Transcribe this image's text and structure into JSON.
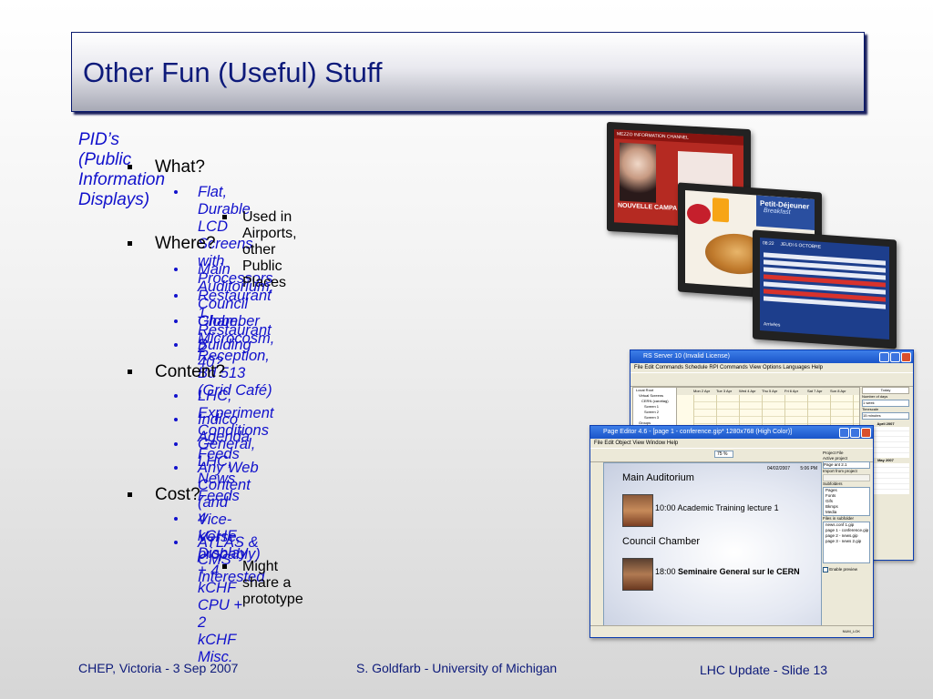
{
  "slide": {
    "title": "Other Fun (Useful) Stuff",
    "outline": {
      "heading": "PID’s (Public Information Displays)",
      "what_label": "What?",
      "what_item": "Flat, Durable LCD Screens with Processors",
      "what_sub": "Used in Airports, other Public Places",
      "where_label": "Where?",
      "where_items": [
        "Main Auditorium, Council Chamber",
        "Restaurant 1, Restaurant 2",
        "Globe, Microcosm, Reception, Bd 513 (Grid Café)",
        "Building 40?"
      ],
      "content_label": "Content?",
      "content_items": [
        "LHC, Experiment Conditions",
        "Indico Agenda Feeds",
        "General, LHC, News Feeds",
        "Any Web Content (and Vice-Verse, probably)"
      ],
      "cost_label": "Cost?",
      "cost_items": [
        "4 kCHF Display + 4 kCHF CPU + 2 kCHF Misc.",
        "ATLAS & CMS Interested"
      ],
      "cost_sub": "Might share a prototype"
    },
    "footer": {
      "left": "CHEP, Victoria - 3 Sep 2007",
      "center": "S. Goldfarb - University of Michigan",
      "right": "LHC Update - Slide 13"
    }
  },
  "screens": {
    "screen1": {
      "header": "MEZZO INFORMATION CHANNEL",
      "tagline": "NOUVELLE CAMPA"
    },
    "screen2": {
      "title": "Petit-Déjeuner",
      "subtitle": "Breakfast"
    },
    "screen3": {
      "time": "08:22",
      "date": "JEUDI 6 OCTOBRE",
      "caption": "Arrivées"
    }
  },
  "scheduler_window": {
    "title": "RS Server 10 (Invalid License)",
    "menu": "File  Edit  Commands  Schedule  RPI Commands  View  Options  Languages  Help",
    "columns": [
      "Mon 2 Apr",
      "Tue 3 Apr",
      "Wed 4 Apr",
      "Thu 5 Apr",
      "Fri 6 Apr",
      "Sat 7 Apr",
      "Sun 8 Apr"
    ],
    "today_label": "Today",
    "days_label": "Number of days",
    "days_value": "1 week",
    "timescale_label": "Timescale",
    "timescale_value": "15 minutes",
    "month1": "April 2007",
    "month2": "May 2007",
    "tree": [
      "Local Root",
      "Virtual Screens",
      "CERN (carottag)",
      "Screen 1",
      "Screen 2",
      "Screen 3",
      "Groups",
      "RS6",
      "Surface",
      "Screen 1",
      "Screen 2"
    ]
  },
  "page_editor_window": {
    "title": "Page Editor 4.6 - [page 1 - conference.gip* 1280x768 (High Color)]",
    "menu": "File  Edit  Object  View  Window  Help",
    "zoom": "75 %",
    "date": "04/02/2007",
    "clock": "5:06 PM",
    "room1": "Main Auditorium",
    "time1": "10:00",
    "event1": "Academic Training lecture 1",
    "room2": "Council Chamber",
    "time2": "18:00",
    "event2": "Seminaire General sur le CERN",
    "panel_tabs": "Project   File",
    "active_project_label": "Active project",
    "active_project_value": "Page ant 2.1",
    "import_label": "Import from project",
    "subfolders_label": "Subfolders",
    "subfolders": [
      "Pages",
      "Fonts",
      "Gifs",
      "Bkmps",
      "Media"
    ],
    "files_label": "Files in subfolder",
    "files": [
      "news.conf 1.gip",
      "page 1 - conference.gip",
      "page 2 - news.gip",
      "page 3 - news 2.gip"
    ],
    "preview_label": "Enable preview",
    "status": "NUM_LOK"
  }
}
